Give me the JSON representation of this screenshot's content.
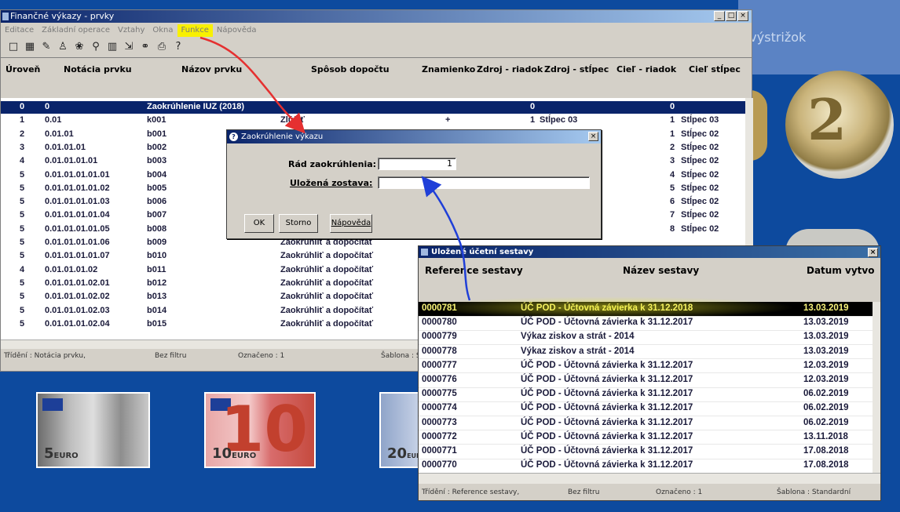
{
  "desktop": {
    "right_text": "Pravouhlý výstrižok"
  },
  "main_window": {
    "title": "Finančné výkazy - prvky",
    "menu": [
      "Editace",
      "Základní operace",
      "Vztahy",
      "Okna",
      "Funkce",
      "Nápověda"
    ],
    "highlight_menu_index": 4,
    "toolbar_icons": [
      "new-icon",
      "table-icon",
      "edit-icon",
      "users-icon",
      "tree-icon",
      "filter-icon",
      "grid-icon",
      "export-icon",
      "link-icon",
      "print-icon",
      "help-icon"
    ],
    "columns": [
      "Úroveň",
      "Notácia prvku",
      "Názov prvku",
      "Spôsob dopočtu",
      "Znamienko",
      "Zdroj - riadok",
      "Zdroj - stĺpec",
      "Cieľ - riadok",
      "Cieľ stĺpec"
    ],
    "rows": [
      {
        "level": "0",
        "notation": "0",
        "name": "Zaokrúhlenie IUZ (2018)",
        "method": "",
        "sign": "",
        "src_row": "0",
        "src_col": "",
        "dst_row": "0",
        "dst_col": ""
      },
      {
        "level": "1",
        "notation": "0.01",
        "name": "k001",
        "method": "Zlúčiť",
        "sign": "+",
        "src_row": "1",
        "src_col": "Stĺpec 03",
        "dst_row": "1",
        "dst_col": "Stĺpec 03"
      },
      {
        "level": "2",
        "notation": "0.01.01",
        "name": "b001",
        "method": "",
        "sign": "",
        "src_row": "",
        "src_col": "",
        "dst_row": "1",
        "dst_col": "Stĺpec 02"
      },
      {
        "level": "3",
        "notation": "0.01.01.01",
        "name": "b002",
        "method": "",
        "sign": "",
        "src_row": "",
        "src_col": "",
        "dst_row": "2",
        "dst_col": "Stĺpec 02"
      },
      {
        "level": "4",
        "notation": "0.01.01.01.01",
        "name": "b003",
        "method": "",
        "sign": "",
        "src_row": "",
        "src_col": "",
        "dst_row": "3",
        "dst_col": "Stĺpec 02"
      },
      {
        "level": "5",
        "notation": "0.01.01.01.01.01",
        "name": "b004",
        "method": "",
        "sign": "",
        "src_row": "",
        "src_col": "",
        "dst_row": "4",
        "dst_col": "Stĺpec 02"
      },
      {
        "level": "5",
        "notation": "0.01.01.01.01.02",
        "name": "b005",
        "method": "",
        "sign": "",
        "src_row": "",
        "src_col": "",
        "dst_row": "5",
        "dst_col": "Stĺpec 02"
      },
      {
        "level": "5",
        "notation": "0.01.01.01.01.03",
        "name": "b006",
        "method": "",
        "sign": "",
        "src_row": "",
        "src_col": "",
        "dst_row": "6",
        "dst_col": "Stĺpec 02"
      },
      {
        "level": "5",
        "notation": "0.01.01.01.01.04",
        "name": "b007",
        "method": "",
        "sign": "",
        "src_row": "",
        "src_col": "",
        "dst_row": "7",
        "dst_col": "Stĺpec 02"
      },
      {
        "level": "5",
        "notation": "0.01.01.01.01.05",
        "name": "b008",
        "method": "",
        "sign": "",
        "src_row": "",
        "src_col": "",
        "dst_row": "8",
        "dst_col": "Stĺpec 02"
      },
      {
        "level": "5",
        "notation": "0.01.01.01.01.06",
        "name": "b009",
        "method": "Zaokrúhliť a dopočítať",
        "sign": "",
        "src_row": "",
        "src_col": "",
        "dst_row": "",
        "dst_col": ""
      },
      {
        "level": "5",
        "notation": "0.01.01.01.01.07",
        "name": "b010",
        "method": "Zaokrúhliť a dopočítať",
        "sign": "",
        "src_row": "",
        "src_col": "",
        "dst_row": "",
        "dst_col": ""
      },
      {
        "level": "4",
        "notation": "0.01.01.01.02",
        "name": "b011",
        "method": "Zaokrúhliť a dopočítať",
        "sign": "",
        "src_row": "",
        "src_col": "",
        "dst_row": "",
        "dst_col": ""
      },
      {
        "level": "5",
        "notation": "0.01.01.01.02.01",
        "name": "b012",
        "method": "Zaokrúhliť a dopočítať",
        "sign": "",
        "src_row": "",
        "src_col": "",
        "dst_row": "",
        "dst_col": ""
      },
      {
        "level": "5",
        "notation": "0.01.01.01.02.02",
        "name": "b013",
        "method": "Zaokrúhliť a dopočítať",
        "sign": "",
        "src_row": "",
        "src_col": "",
        "dst_row": "",
        "dst_col": ""
      },
      {
        "level": "5",
        "notation": "0.01.01.01.02.03",
        "name": "b014",
        "method": "Zaokrúhliť a dopočítať",
        "sign": "",
        "src_row": "",
        "src_col": "",
        "dst_row": "",
        "dst_col": ""
      },
      {
        "level": "5",
        "notation": "0.01.01.01.02.04",
        "name": "b015",
        "method": "Zaokrúhliť a dopočítať",
        "sign": "",
        "src_row": "",
        "src_col": "",
        "dst_row": "",
        "dst_col": ""
      }
    ],
    "status": {
      "sort": "Třídění : Notácia prvku,",
      "filter": "Bez filtru",
      "marked": "Označeno : 1",
      "template": "Šablona : Stand"
    }
  },
  "dialog": {
    "title": "Zaokrúhlenie výkazu",
    "round_label": "Rád zaokrúhlenia:",
    "round_value": "1",
    "saved_label": "Uložená zostava:",
    "saved_value": "",
    "ok": "OK",
    "cancel": "Storno",
    "help": "Nápověda"
  },
  "reports_window": {
    "title": "Uložené účetní sestavy",
    "columns": [
      "Reference sestavy",
      "Název sestavy",
      "Datum vytvo"
    ],
    "rows": [
      {
        "ref": "0000781",
        "name": "ÚČ POD - Účtovná závierka k 31.12.2018",
        "date": "13.03.2019"
      },
      {
        "ref": "0000780",
        "name": "ÚČ POD - Účtovná závierka k 31.12.2017",
        "date": "13.03.2019"
      },
      {
        "ref": "0000779",
        "name": "Výkaz ziskov a strát - 2014",
        "date": "13.03.2019"
      },
      {
        "ref": "0000778",
        "name": "Výkaz ziskov a strát - 2014",
        "date": "13.03.2019"
      },
      {
        "ref": "0000777",
        "name": "ÚČ POD - Účtovná závierka k 31.12.2017",
        "date": "12.03.2019"
      },
      {
        "ref": "0000776",
        "name": "ÚČ POD - Účtovná závierka k 31.12.2017",
        "date": "12.03.2019"
      },
      {
        "ref": "0000775",
        "name": "ÚČ POD - Účtovná závierka k 31.12.2017",
        "date": "06.02.2019"
      },
      {
        "ref": "0000774",
        "name": "ÚČ POD - Účtovná závierka k 31.12.2017",
        "date": "06.02.2019"
      },
      {
        "ref": "0000773",
        "name": "ÚČ POD - Účtovná závierka k 31.12.2017",
        "date": "06.02.2019"
      },
      {
        "ref": "0000772",
        "name": "ÚČ POD - Účtovná závierka k 31.12.2017",
        "date": "13.11.2018"
      },
      {
        "ref": "0000771",
        "name": "ÚČ POD - Účtovná závierka k 31.12.2017",
        "date": "17.08.2018"
      },
      {
        "ref": "0000770",
        "name": "ÚČ POD - Účtovná závierka k 31.12.2017",
        "date": "17.08.2018"
      }
    ],
    "status": {
      "sort": "Třídění : Reference sestavy,",
      "filter": "Bez filtru",
      "marked": "Označeno : 1",
      "template": "Šablona : Standardní"
    }
  },
  "banknotes": [
    {
      "value": "5",
      "label": "EURO"
    },
    {
      "value": "10",
      "label": "EURO"
    },
    {
      "value": "20",
      "label": "EURO"
    }
  ],
  "coin": {
    "value": "2"
  },
  "colors": {
    "desktop": "#0d4a9e",
    "selection": "#0a246a",
    "highlight": "#f8f000",
    "red_arrow": "#e53030",
    "blue_arrow": "#1f3fd8"
  }
}
